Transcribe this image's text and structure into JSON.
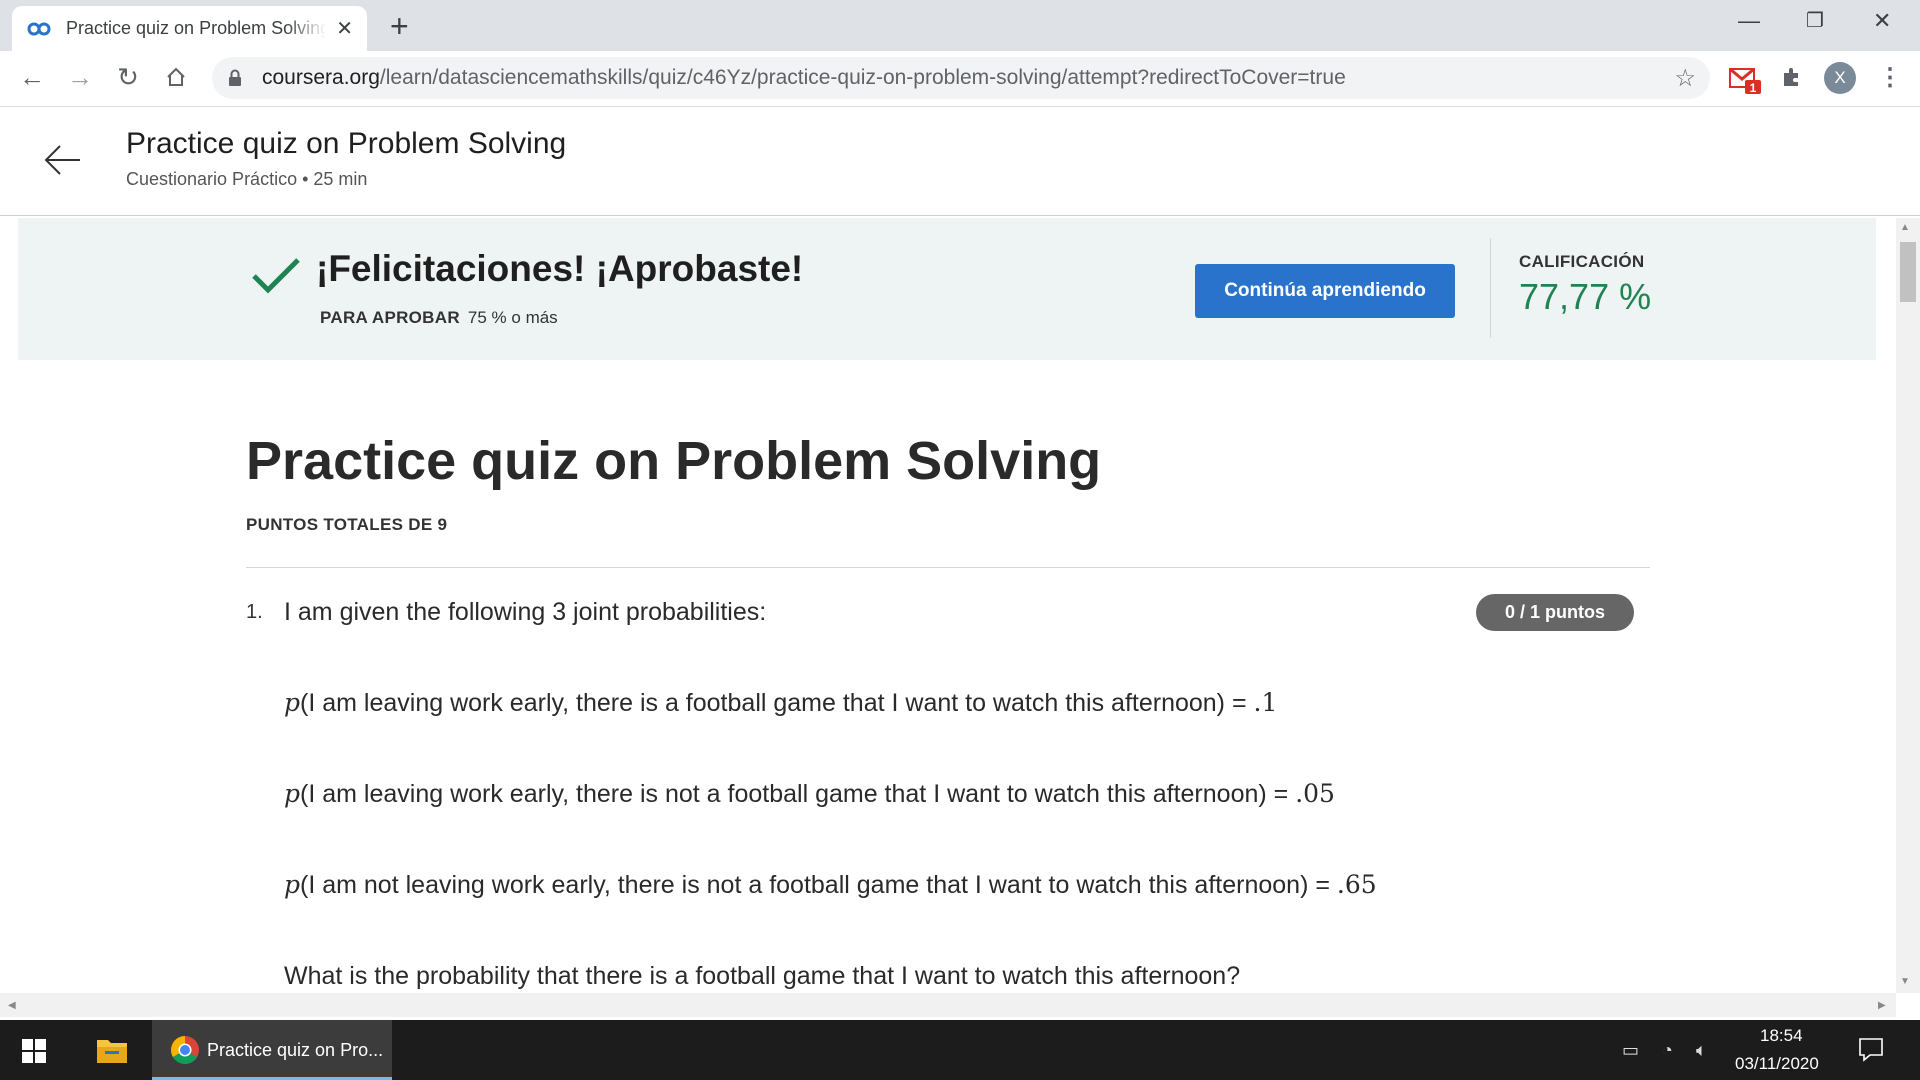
{
  "browser": {
    "tab_title": "Practice quiz on Problem Solving",
    "url_host": "coursera.org",
    "url_path": "/learn/datasciencemathskills/quiz/c46Yz/practice-quiz-on-problem-solving/attempt?redirectToCover=true",
    "gmail_badge": "1",
    "profile_initial": "X"
  },
  "header": {
    "title": "Practice quiz on Problem Solving",
    "subtitle": "Cuestionario Práctico • 25 min"
  },
  "result": {
    "headline": "¡Felicitaciones! ¡Aprobaste!",
    "pass_label": "PARA APROBAR",
    "pass_value": "75 % o más",
    "continue_label": "Continúa aprendiendo",
    "grade_label": "CALIFICACIÓN",
    "grade_value": "77,77 %",
    "accent_color": "#1f8354",
    "button_color": "#2a73cc"
  },
  "quiz": {
    "title": "Practice quiz on Problem Solving",
    "total_points": "PUNTOS TOTALES DE 9",
    "question_number": "1.",
    "question_intro": "I am given the following 3 joint probabilities:",
    "score": "0 / 1 puntos",
    "prob_symbol": "p",
    "probabilities": [
      {
        "text": "(I am leaving work early, there is a football game that I want to watch this afternoon) = ",
        "value": ".1"
      },
      {
        "text": "(I am leaving work early, there is not a football game that I want to watch this afternoon) = ",
        "value": ".05"
      },
      {
        "text": "(I am not leaving work early, there is not a football game that I want to watch this afternoon) = ",
        "value": ".65"
      }
    ],
    "question": "What is the probability that there is a football game that I want to watch this afternoon?"
  },
  "taskbar": {
    "chrome_label": "Practice quiz on Pro...",
    "time": "18:54",
    "date": "03/11/2020"
  }
}
